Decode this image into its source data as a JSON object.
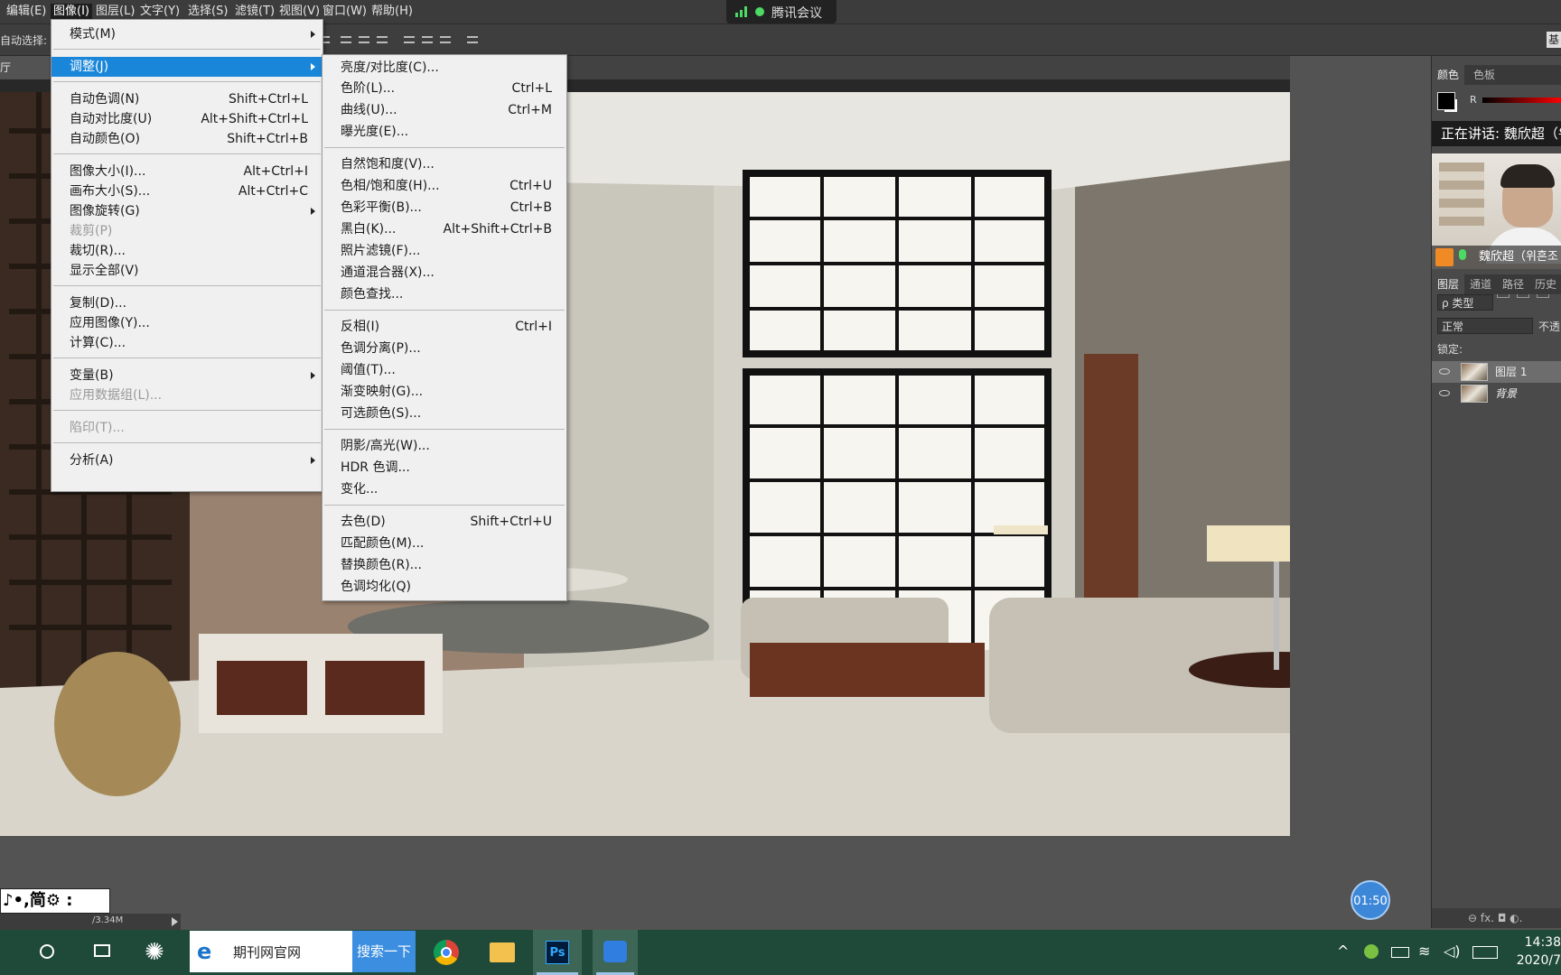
{
  "menubar": {
    "items": [
      "编辑(E)",
      "图像(I)",
      "图层(L)",
      "文字(Y)",
      "选择(S)",
      "滤镜(T)",
      "视图(V)",
      "窗口(W)",
      "帮助(H)"
    ],
    "active_index": 1
  },
  "meeting_pill": {
    "title": "腾讯会议"
  },
  "options_bar": {
    "auto_select_label": "自动选择:",
    "right_button": "基"
  },
  "document_tab": {
    "title": "厅start.psd"
  },
  "image_menu": {
    "items": [
      {
        "label": "模式(M)",
        "shortcut": "",
        "submenu": true,
        "disabled": false
      },
      {
        "label": "调整(J)",
        "shortcut": "",
        "submenu": true,
        "disabled": false,
        "highlighted": true
      },
      {
        "label": "自动色调(N)",
        "shortcut": "Shift+Ctrl+L",
        "submenu": false,
        "disabled": false
      },
      {
        "label": "自动对比度(U)",
        "shortcut": "Alt+Shift+Ctrl+L",
        "submenu": false,
        "disabled": false
      },
      {
        "label": "自动颜色(O)",
        "shortcut": "Shift+Ctrl+B",
        "submenu": false,
        "disabled": false
      },
      {
        "label": "图像大小(I)...",
        "shortcut": "Alt+Ctrl+I",
        "submenu": false,
        "disabled": false
      },
      {
        "label": "画布大小(S)...",
        "shortcut": "Alt+Ctrl+C",
        "submenu": false,
        "disabled": false
      },
      {
        "label": "图像旋转(G)",
        "shortcut": "",
        "submenu": true,
        "disabled": false
      },
      {
        "label": "裁剪(P)",
        "shortcut": "",
        "submenu": false,
        "disabled": true
      },
      {
        "label": "裁切(R)...",
        "shortcut": "",
        "submenu": false,
        "disabled": false
      },
      {
        "label": "显示全部(V)",
        "shortcut": "",
        "submenu": false,
        "disabled": false
      },
      {
        "label": "复制(D)...",
        "shortcut": "",
        "submenu": false,
        "disabled": false
      },
      {
        "label": "应用图像(Y)...",
        "shortcut": "",
        "submenu": false,
        "disabled": false
      },
      {
        "label": "计算(C)...",
        "shortcut": "",
        "submenu": false,
        "disabled": false
      },
      {
        "label": "变量(B)",
        "shortcut": "",
        "submenu": true,
        "disabled": false
      },
      {
        "label": "应用数据组(L)...",
        "shortcut": "",
        "submenu": false,
        "disabled": true
      },
      {
        "label": "陷印(T)...",
        "shortcut": "",
        "submenu": false,
        "disabled": true
      },
      {
        "label": "分析(A)",
        "shortcut": "",
        "submenu": true,
        "disabled": false
      }
    ]
  },
  "adjust_menu": {
    "items": [
      {
        "label": "亮度/对比度(C)...",
        "shortcut": ""
      },
      {
        "label": "色阶(L)...",
        "shortcut": "Ctrl+L"
      },
      {
        "label": "曲线(U)...",
        "shortcut": "Ctrl+M"
      },
      {
        "label": "曝光度(E)...",
        "shortcut": ""
      },
      {
        "label": "自然饱和度(V)...",
        "shortcut": ""
      },
      {
        "label": "色相/饱和度(H)...",
        "shortcut": "Ctrl+U"
      },
      {
        "label": "色彩平衡(B)...",
        "shortcut": "Ctrl+B"
      },
      {
        "label": "黑白(K)...",
        "shortcut": "Alt+Shift+Ctrl+B"
      },
      {
        "label": "照片滤镜(F)...",
        "shortcut": ""
      },
      {
        "label": "通道混合器(X)...",
        "shortcut": ""
      },
      {
        "label": "颜色查找...",
        "shortcut": ""
      },
      {
        "label": "反相(I)",
        "shortcut": "Ctrl+I"
      },
      {
        "label": "色调分离(P)...",
        "shortcut": ""
      },
      {
        "label": "阈值(T)...",
        "shortcut": ""
      },
      {
        "label": "渐变映射(G)...",
        "shortcut": ""
      },
      {
        "label": "可选颜色(S)...",
        "shortcut": ""
      },
      {
        "label": "阴影/高光(W)...",
        "shortcut": ""
      },
      {
        "label": "HDR 色调...",
        "shortcut": ""
      },
      {
        "label": "变化...",
        "shortcut": ""
      },
      {
        "label": "去色(D)",
        "shortcut": "Shift+Ctrl+U"
      },
      {
        "label": "匹配颜色(M)...",
        "shortcut": ""
      },
      {
        "label": "替换颜色(R)...",
        "shortcut": ""
      },
      {
        "label": "色调均化(Q)",
        "shortcut": ""
      }
    ]
  },
  "right_panel": {
    "color_tabs": [
      "颜色",
      "色板"
    ],
    "channel_label": "R",
    "speaking_text": "正在讲话: 魏欣超（위",
    "participant_name": "魏欣超（위흔조",
    "layer_tabs": [
      "图层",
      "通道",
      "路径",
      "历史"
    ],
    "filter_kind": "ρ 类型",
    "blend_mode": "正常",
    "opacity_label": "不透",
    "lock_label": "锁定:",
    "layers": [
      {
        "name": "图层 1",
        "selected": true
      },
      {
        "name": "背景",
        "selected": false
      }
    ],
    "bottom_icons": "⊖ fx. ◘ ◐."
  },
  "status": {
    "doc_size": "/3.34M"
  },
  "ime_bar": {
    "text": "♪•,简⚙ :"
  },
  "timer": {
    "value": "01:50"
  },
  "taskbar": {
    "search_text": "期刊网官网",
    "search_button": "搜索一下",
    "ps_label": "Ps",
    "time": "14:38",
    "date": "2020/7"
  },
  "colors": {
    "menu_highlight": "#1a86d9",
    "taskbar": "#1f4a3a",
    "tencent_green": "#4cd964"
  }
}
